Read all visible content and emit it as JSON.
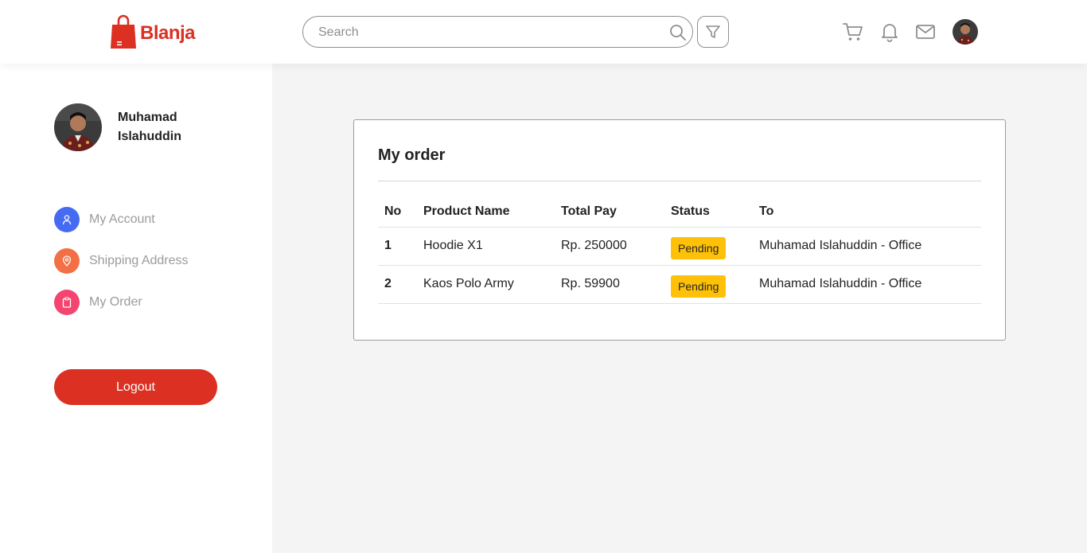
{
  "brand": {
    "name": "Blanja",
    "color": "#db3022"
  },
  "search": {
    "placeholder": "Search",
    "value": ""
  },
  "navbar": {
    "icons": [
      "search-icon",
      "filter-icon",
      "cart-icon",
      "bell-icon",
      "mail-icon",
      "avatar"
    ]
  },
  "sidebar": {
    "user_name": "Muhamad Islahuddin",
    "menu": [
      {
        "label": "My Account",
        "icon": "user-icon",
        "color": "#456bf3"
      },
      {
        "label": "Shipping Address",
        "icon": "location-pin-icon",
        "color": "#f36f45"
      },
      {
        "label": "My Order",
        "icon": "clipboard-icon",
        "color": "#f3456f"
      }
    ],
    "logout_label": "Logout"
  },
  "orders": {
    "title": "My order",
    "columns": [
      "No",
      "Product Name",
      "Total Pay",
      "Status",
      "To"
    ],
    "rows": [
      {
        "no": "1",
        "product": "Hoodie X1",
        "total": "Rp. 250000",
        "status": "Pending",
        "to": "Muhamad Islahuddin - Office"
      },
      {
        "no": "2",
        "product": "Kaos Polo Army",
        "total": "Rp. 59900",
        "status": "Pending",
        "to": "Muhamad Islahuddin - Office"
      }
    ],
    "status_color": "#ffc107"
  }
}
